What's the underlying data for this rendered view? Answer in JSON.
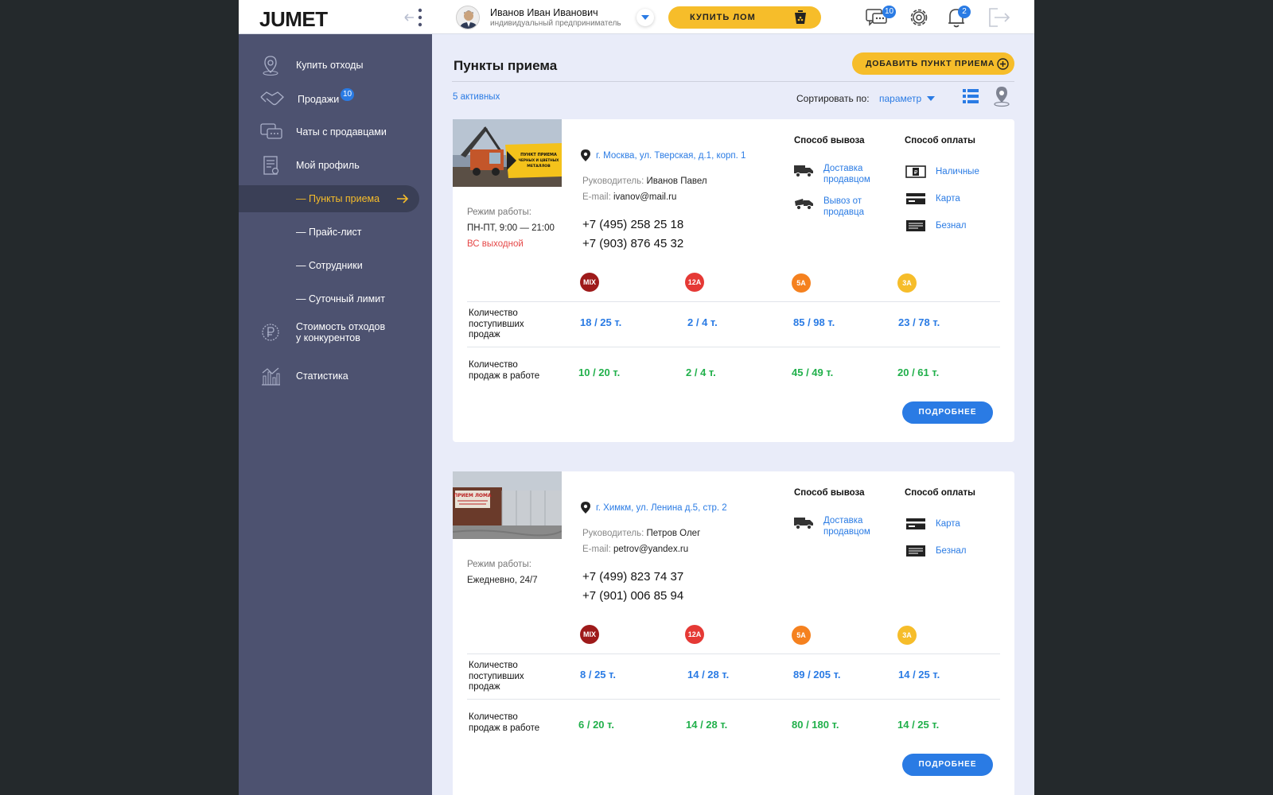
{
  "header": {
    "logo": "JUMET",
    "user_name": "Иванов Иван Иванович",
    "user_role": "индивидуальный предприниматель",
    "buy_button": "КУПИТЬ ЛОМ",
    "chat_badge": "10",
    "notif_badge": "2"
  },
  "sidebar": {
    "items": [
      {
        "label": "Купить отходы"
      },
      {
        "label": "Продажи",
        "badge": "10"
      },
      {
        "label": "Чаты с продавцами"
      },
      {
        "label": "Мой профиль"
      },
      {
        "label": "— Пункты приема"
      },
      {
        "label": "— Прайс-лист"
      },
      {
        "label": "— Сотрудники"
      },
      {
        "label": "— Суточный лимит"
      },
      {
        "label_line1": "Стоимость отходов",
        "label_line2": "у конкурентов"
      },
      {
        "label": "Статистика"
      }
    ]
  },
  "main": {
    "title": "Пункты приема",
    "add_button": "ДОБАВИТЬ ПУНКТ ПРИЕМА",
    "active_count": "5 активных",
    "sort_label": "Сортировать по:",
    "sort_value": "параметр"
  },
  "labels": {
    "hours": "Режим работы:",
    "manager": "Руководитель:",
    "email": "E-mail:",
    "pickup": "Способ вывоза",
    "payment": "Способ оплаты",
    "received_1": "Количество",
    "received_2": "поступивших",
    "received_3": "продаж",
    "inwork_1": "Количество",
    "inwork_2": "продаж в работе",
    "more": "ПОДРОБНЕЕ"
  },
  "grades": [
    "MIX",
    "12A",
    "5A",
    "3A"
  ],
  "grade_colors": [
    "#9e1a1a",
    "#e53935",
    "#f5811f",
    "#f6bd2a"
  ],
  "cards": [
    {
      "address": "г. Москва, ул. Тверская, д.1, корп. 1",
      "manager": "Иванов Павел",
      "email": "ivanov@mail.ru",
      "phone1": "+7 (495) 258 25 18",
      "phone2": "+7 (903) 876 45 32",
      "hours": "ПН-ПТ,  9:00 — 21:00",
      "hours_off": "ВС выходной",
      "photo_sign": "ПУНКТ ПРИЕМА ЧЕРНЫХ И ЦВЕТНЫХ МЕТАЛЛОВ",
      "pickup": [
        {
          "line1": "Доставка",
          "line2": "продавцом",
          "icon": "delivery-truck-icon"
        },
        {
          "line1": "Вывоз от",
          "line2": "продавца",
          "icon": "pickup-truck-icon"
        }
      ],
      "payment": [
        {
          "label": "Наличные",
          "icon": "cash-icon"
        },
        {
          "label": "Карта",
          "icon": "card-icon"
        },
        {
          "label": "Безнал",
          "icon": "invoice-icon"
        }
      ],
      "received": [
        "18 / 25 т.",
        "2 / 4 т.",
        "85 / 98 т.",
        "23 / 78 т."
      ],
      "in_work": [
        "10 / 20 т.",
        "2 / 4 т.",
        "45 / 49 т.",
        "20 / 61 т."
      ]
    },
    {
      "address": "г. Химкм, ул. Ленина д.5, стр. 2",
      "manager": "Петров Олег",
      "email": "petrov@yandex.ru",
      "phone1": "+7 (499) 823 74 37",
      "phone2": "+7 (901) 006 85 94",
      "hours": "Ежедневно,  24/7",
      "photo_sign": "ПРИЕМ ЛОМА",
      "pickup": [
        {
          "line1": "Доставка",
          "line2": "продавцом",
          "icon": "delivery-truck-icon"
        }
      ],
      "payment": [
        {
          "label": "Карта",
          "icon": "card-icon"
        },
        {
          "label": "Безнал",
          "icon": "invoice-icon"
        }
      ],
      "received": [
        "8 / 25 т.",
        "14 / 28 т.",
        "89 / 205 т.",
        "14 / 25 т."
      ],
      "in_work": [
        "6 / 20 т.",
        "14 / 28 т.",
        "80 / 180 т.",
        "14 / 25 т."
      ]
    }
  ]
}
